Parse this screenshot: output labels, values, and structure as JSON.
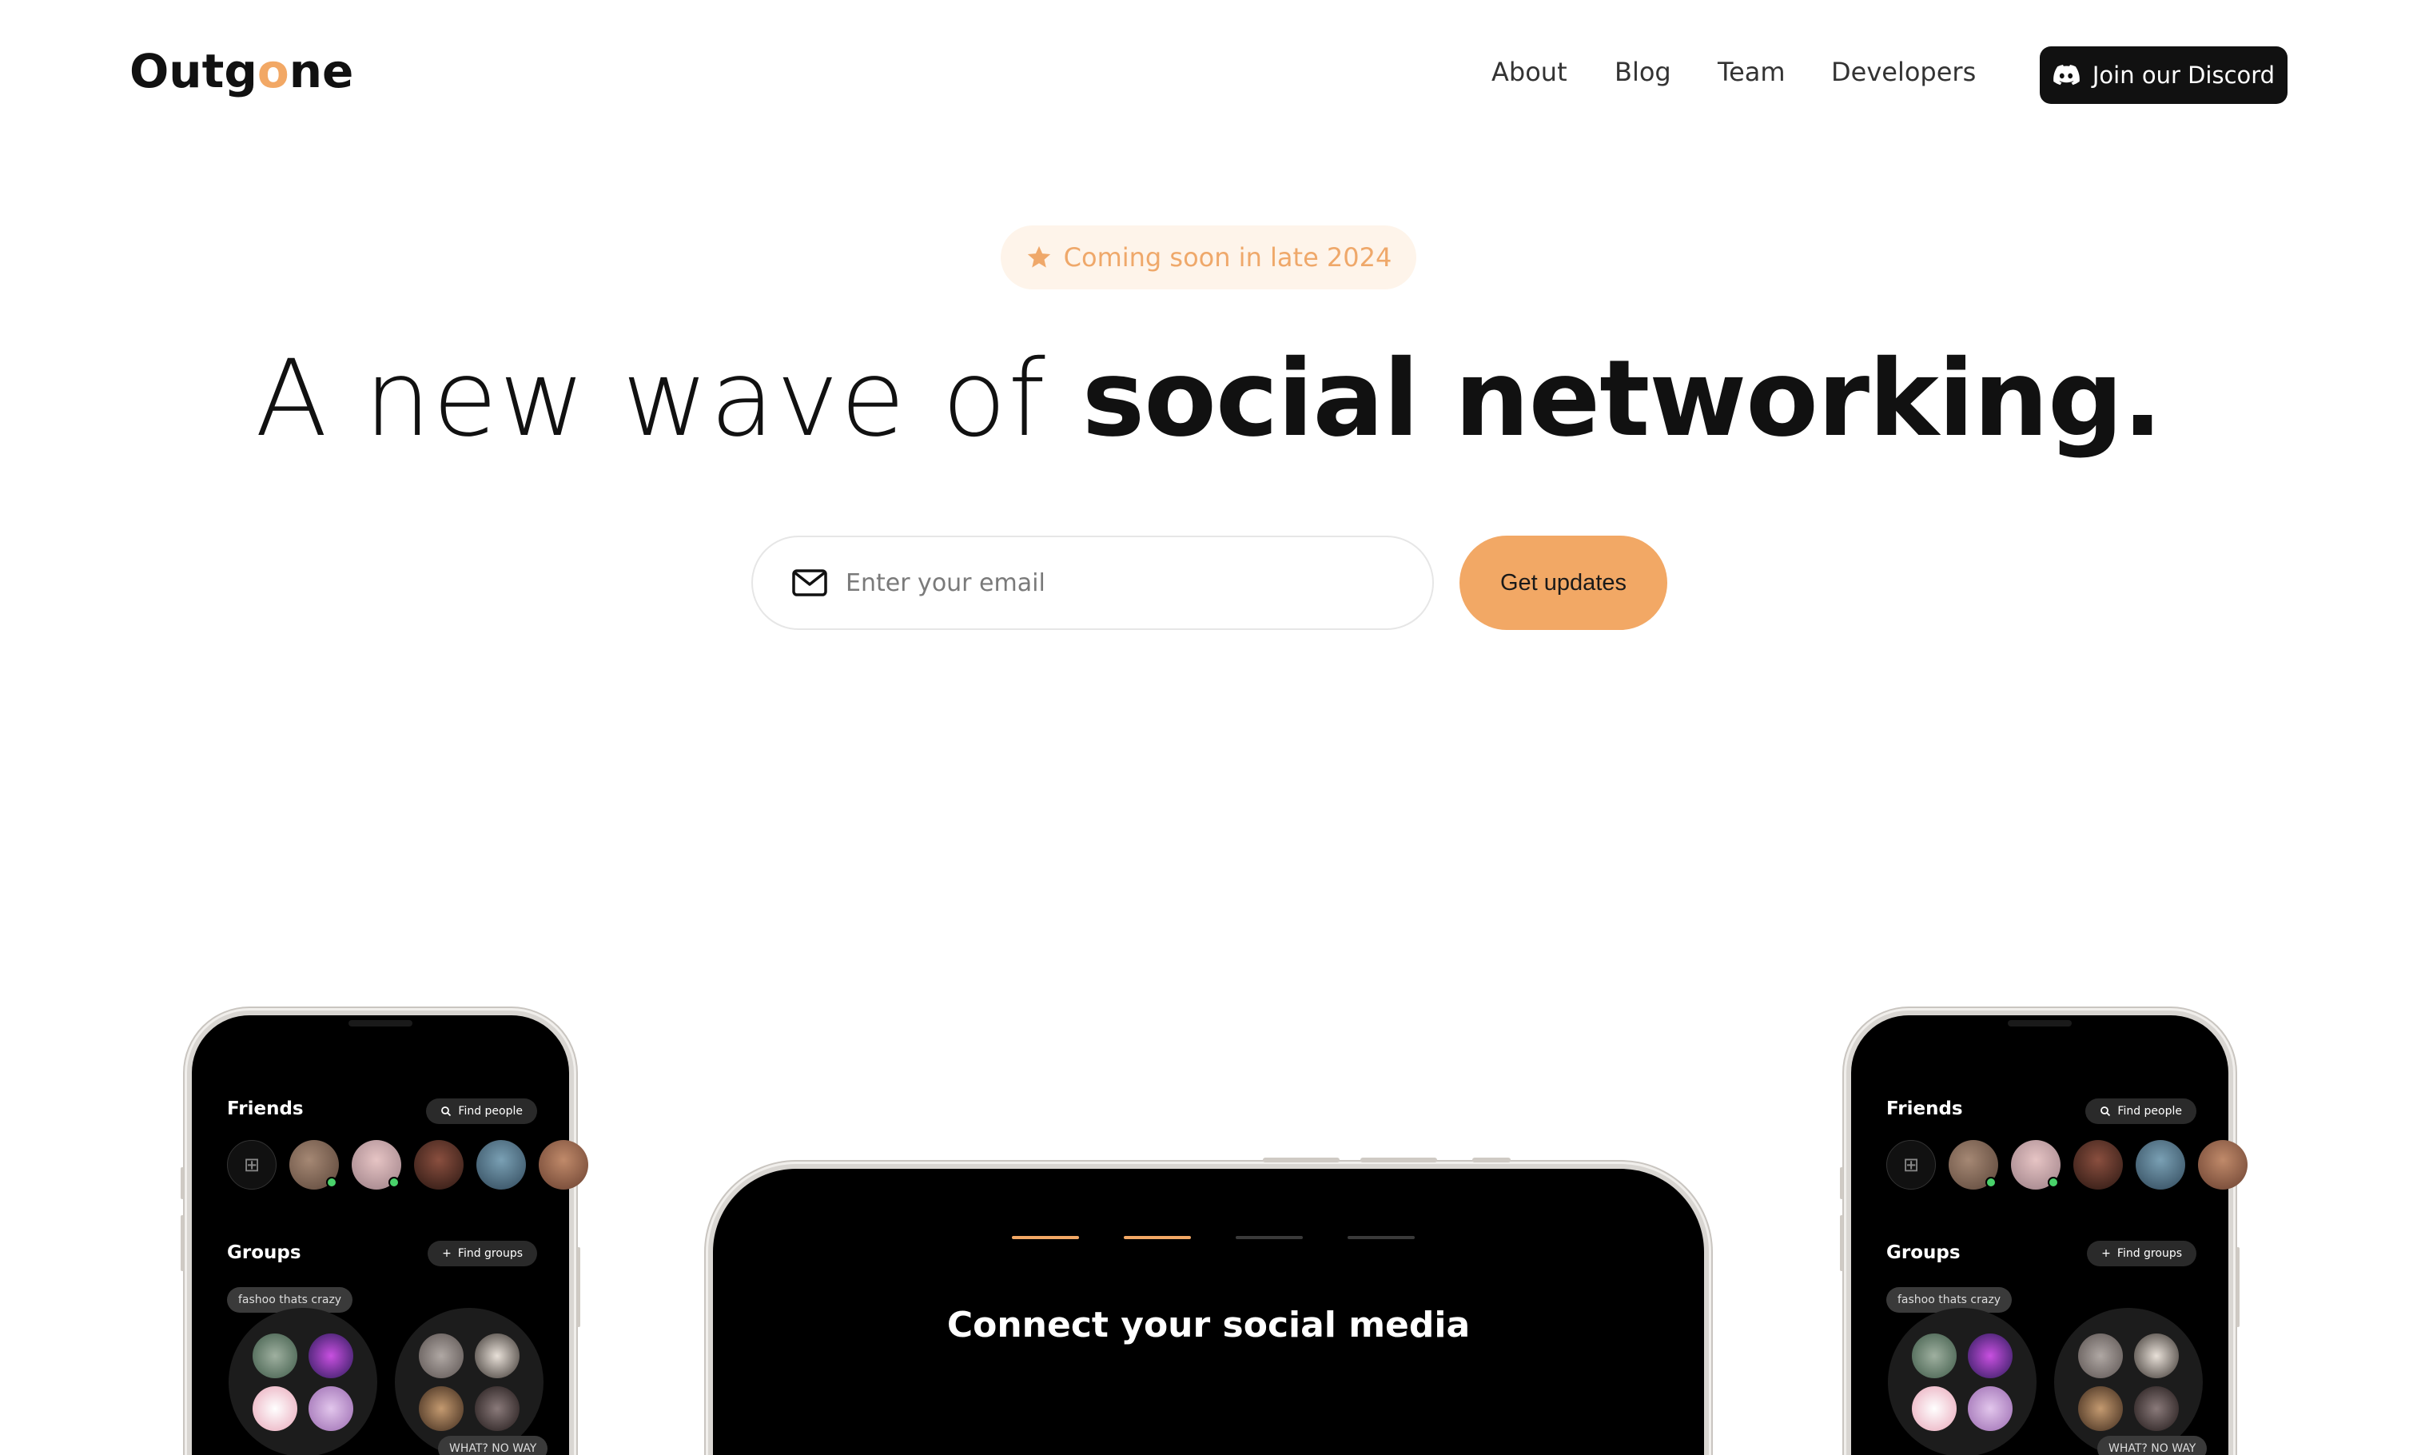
{
  "brand": {
    "logo_pre": "Outg",
    "logo_dot": "o",
    "logo_post": "ne",
    "accent": "#F2A865"
  },
  "nav": {
    "about": "About",
    "blog": "Blog",
    "team": "Team",
    "developers": "Developers",
    "discord": "Join our Discord"
  },
  "badge": {
    "text": "Coming soon in late 2024",
    "icon": "star-icon"
  },
  "hero": {
    "headline_light": "A new wave of ",
    "headline_bold": "social networking."
  },
  "signup": {
    "placeholder": "Enter your email",
    "button": "Get updates",
    "icon": "mail-icon"
  },
  "phone": {
    "friends_title": "Friends",
    "find_people": "Find people",
    "groups_title": "Groups",
    "find_groups": "Find groups",
    "bubble_1": "fashoo thats crazy",
    "bubble_2": "WHAT? NO WAY"
  },
  "center_phone": {
    "title": "Connect your social media",
    "steps_total": 4,
    "steps_active": 2
  }
}
